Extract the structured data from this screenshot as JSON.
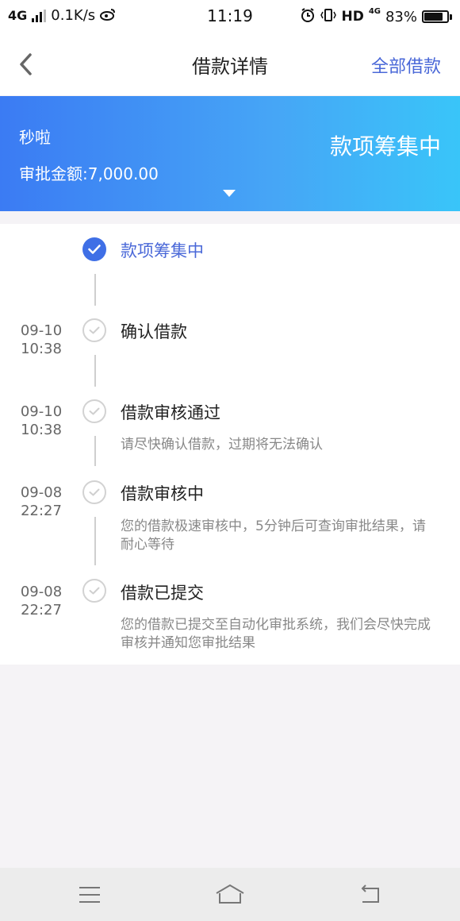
{
  "status_bar": {
    "network": "4G",
    "speed": "0.1K/s",
    "time": "11:19",
    "hd": "HD",
    "net4g": "4G",
    "battery": "83%",
    "battery_level": 0.83,
    "icons": [
      "signal-icon",
      "weibo-icon",
      "alarm-icon",
      "vibrate-icon",
      "battery-icon"
    ]
  },
  "header": {
    "title": "借款详情",
    "right_link": "全部借款",
    "back_icon": "chevron-left-icon"
  },
  "banner": {
    "name": "秒啦",
    "amount": "审批金额:7,000.00",
    "status": "款项筹集中"
  },
  "timeline": {
    "items": [
      {
        "title": "款项筹集中",
        "date": "",
        "time": "",
        "desc": "",
        "state": "active"
      },
      {
        "title": "确认借款",
        "date": "09-10",
        "time": "10:38",
        "desc": "",
        "state": "done"
      },
      {
        "title": "借款审核通过",
        "date": "09-10",
        "time": "10:38",
        "desc": "请尽快确认借款，过期将无法确认",
        "state": "done"
      },
      {
        "title": "借款审核中",
        "date": "09-08",
        "time": "22:27",
        "desc": "您的借款极速审核中，5分钟后可查询审批结果，请耐心等待",
        "state": "done"
      },
      {
        "title": "借款已提交",
        "date": "09-08",
        "time": "22:27",
        "desc": "您的借款已提交至自动化审批系统，我们会尽快完成审核并通知您审批结果",
        "state": "done"
      }
    ]
  },
  "navbar": {
    "icons": [
      "menu-icon",
      "home-icon",
      "back-icon"
    ]
  },
  "colors": {
    "accent": "#4a68d8",
    "banner_start": "#3b7bf3",
    "banner_end": "#39c5f9",
    "background": "#f5f3f6"
  }
}
